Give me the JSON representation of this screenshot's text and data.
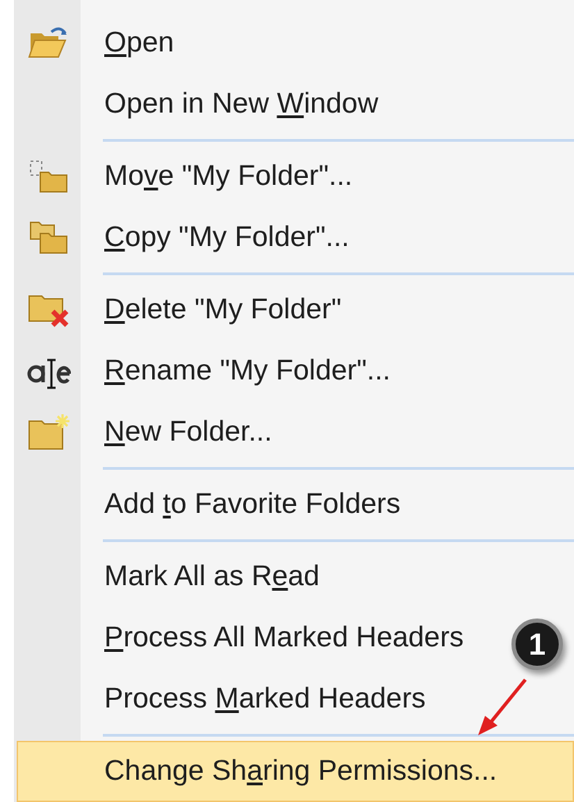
{
  "menu": {
    "items": [
      {
        "kind": "item",
        "access_key": "O",
        "label_after": "pen",
        "selected": false
      },
      {
        "kind": "item",
        "label_before": "Open in New ",
        "access_key": "W",
        "label_after": "indow",
        "selected": false
      },
      {
        "kind": "separator"
      },
      {
        "kind": "item",
        "label_before": "Mo",
        "access_key": "v",
        "label_after": "e \"My Folder\"...",
        "selected": false
      },
      {
        "kind": "item",
        "access_key": "C",
        "label_after": "opy \"My Folder\"...",
        "selected": false
      },
      {
        "kind": "separator"
      },
      {
        "kind": "item",
        "access_key": "D",
        "label_after": "elete \"My Folder\"",
        "selected": false
      },
      {
        "kind": "item",
        "access_key": "R",
        "label_after": "ename \"My Folder\"...",
        "selected": false
      },
      {
        "kind": "item",
        "access_key": "N",
        "label_after": "ew Folder...",
        "selected": false
      },
      {
        "kind": "separator"
      },
      {
        "kind": "item",
        "label_before": "Add ",
        "access_key": "t",
        "label_after": "o Favorite Folders",
        "selected": false
      },
      {
        "kind": "separator"
      },
      {
        "kind": "item",
        "label_before": "Mark All as R",
        "access_key": "e",
        "label_after": "ad",
        "selected": false
      },
      {
        "kind": "item",
        "access_key": "P",
        "label_after": "rocess All Marked Headers",
        "selected": false
      },
      {
        "kind": "item",
        "label_before": "Process ",
        "access_key": "M",
        "label_after": "arked Headers",
        "selected": false
      },
      {
        "kind": "separator"
      },
      {
        "kind": "item",
        "label_before": "Change Sh",
        "access_key": "a",
        "label_after": "ring Permissions...",
        "selected": true
      }
    ]
  },
  "callout": {
    "number": "1"
  }
}
